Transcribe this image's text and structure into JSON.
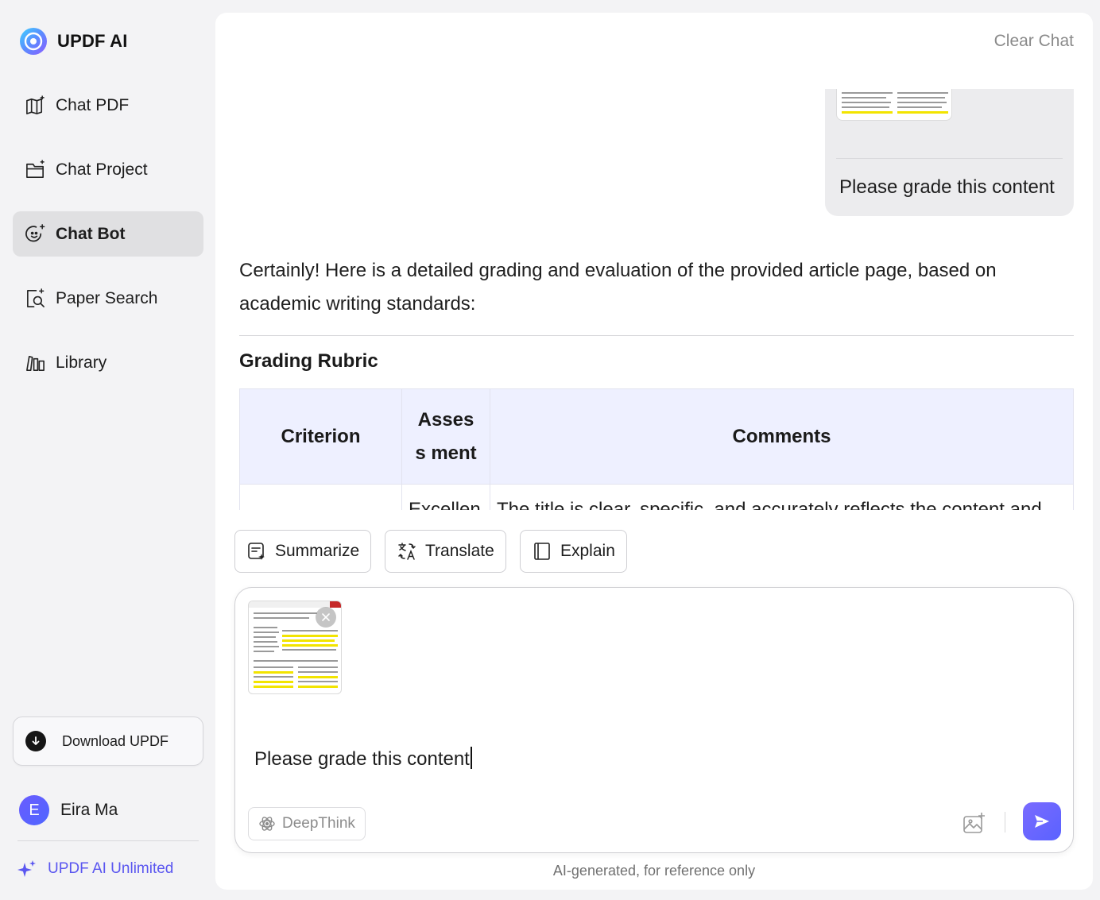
{
  "sidebar": {
    "brand": "UPDF AI",
    "items": [
      {
        "label": "Chat PDF",
        "icon": "map-sparkle-icon"
      },
      {
        "label": "Chat Project",
        "icon": "folder-sparkle-icon"
      },
      {
        "label": "Chat Bot",
        "icon": "bot-sparkle-icon",
        "active": true
      },
      {
        "label": "Paper Search",
        "icon": "doc-search-icon"
      },
      {
        "label": "Library",
        "icon": "books-icon"
      }
    ],
    "download_label": "Download UPDF",
    "user": {
      "initial": "E",
      "name": "Eira Ma"
    },
    "unlimited_label": "UPDF AI Unlimited"
  },
  "header": {
    "clear_chat": "Clear Chat"
  },
  "chat": {
    "user_message": "Please grade this content",
    "ai_intro": "Certainly! Here is a detailed grading and evaluation of the provided article page, based on academic writing standards:",
    "ai_heading": "Grading Rubric",
    "table": {
      "headers": [
        "Criterion",
        "Assess ment",
        "Comments"
      ],
      "row": [
        "",
        "Excellen",
        "The title is clear, specific, and accurately reflects the content and"
      ]
    }
  },
  "actions": {
    "summarize": "Summarize",
    "translate": "Translate",
    "explain": "Explain"
  },
  "composer": {
    "text": "Please grade this content",
    "deepthink": "DeepThink"
  },
  "footer": {
    "disclaimer": "AI-generated, for reference only"
  },
  "colors": {
    "accent": "#5a56f0",
    "active_nav": "#e0e0e2",
    "table_header": "#eef0ff"
  }
}
